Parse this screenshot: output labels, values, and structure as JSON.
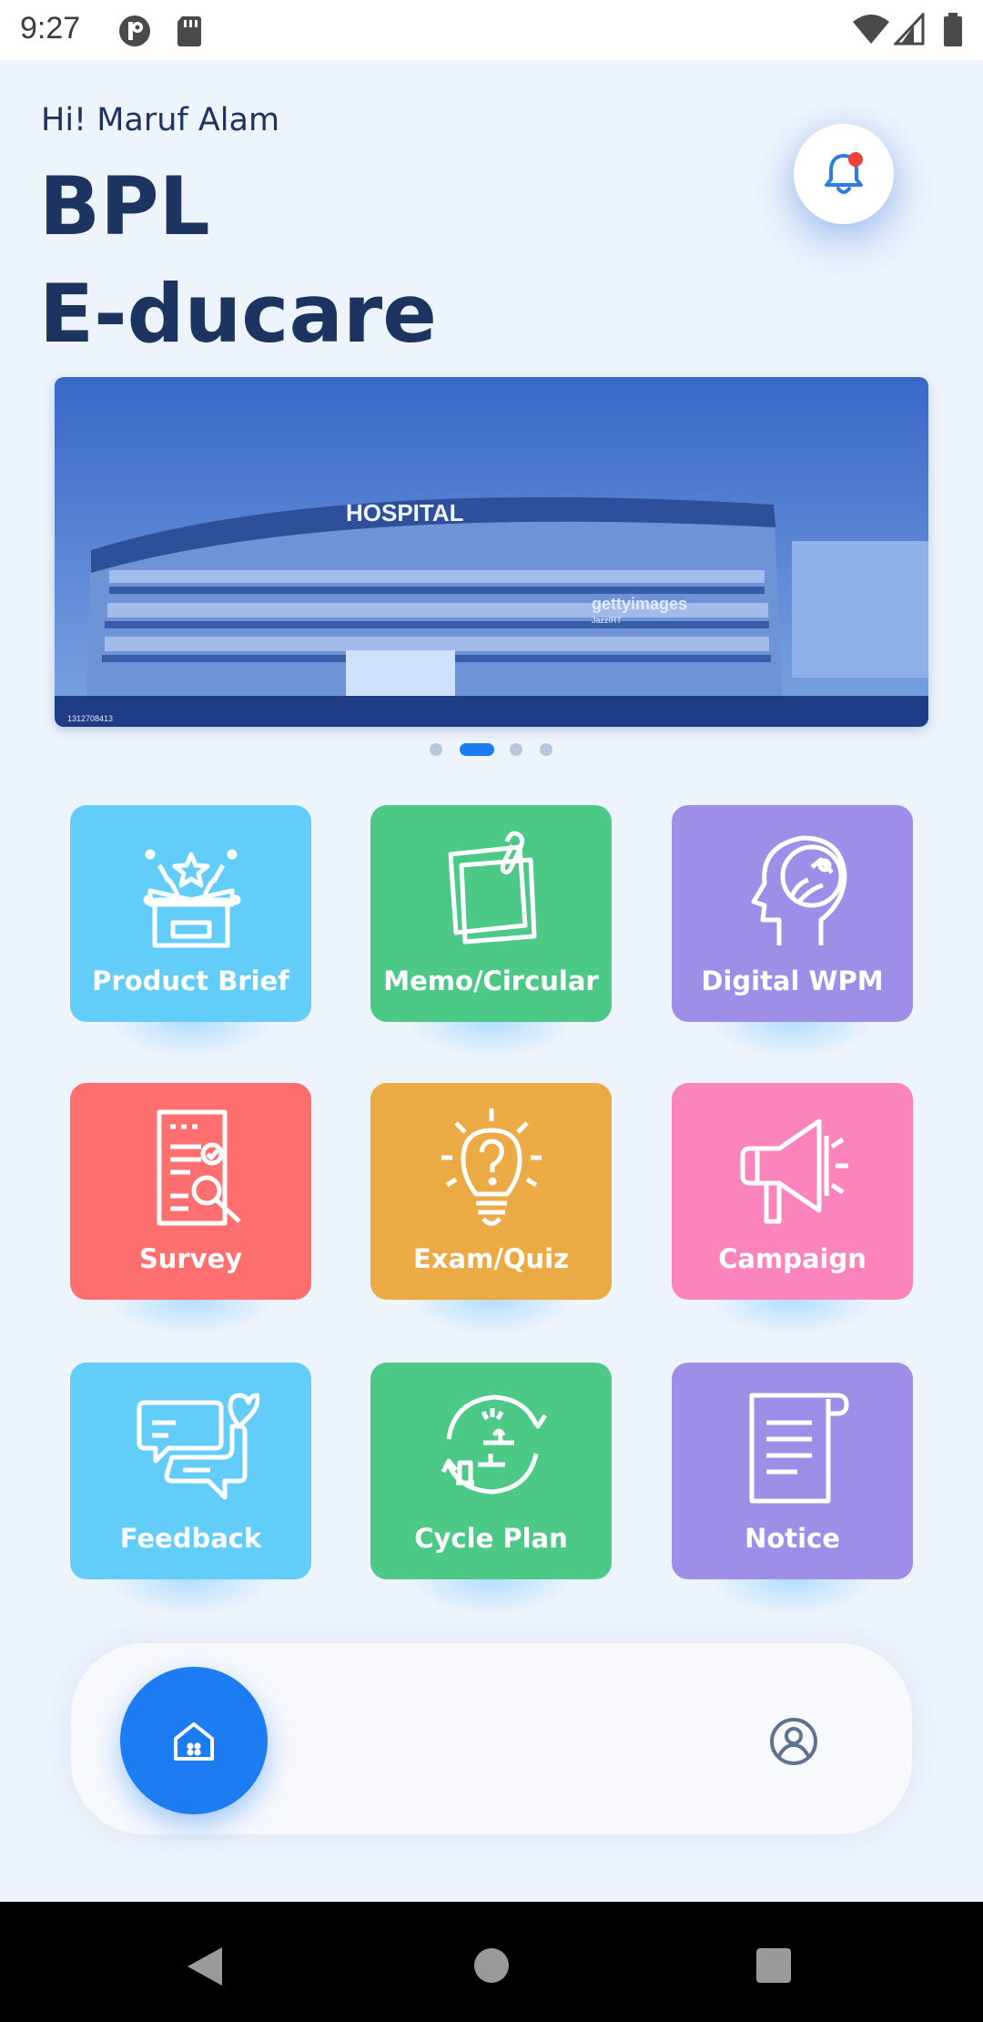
{
  "status_bar": {
    "time": "9:27"
  },
  "header": {
    "greeting": "Hi! Maruf Alam",
    "title_line1": "BPL",
    "title_line2": "E-ducare"
  },
  "banner": {
    "building_sign": "HOSPITAL",
    "watermark": "gettyimages",
    "watermark_credit": "JazzIRT",
    "image_id": "1312708413",
    "slides_total": 4,
    "active_slide": 2
  },
  "tiles": [
    {
      "label": "Product Brief",
      "color": "#63cdfa",
      "icon": "gift-box-icon"
    },
    {
      "label": "Memo/Circular",
      "color": "#4cc986",
      "icon": "memo-paper-icon"
    },
    {
      "label": "Digital WPM",
      "color": "#9f8ee8",
      "icon": "head-image-icon"
    },
    {
      "label": "Survey",
      "color": "#ff6f6f",
      "icon": "survey-document-icon"
    },
    {
      "label": "Exam/Quiz",
      "color": "#ecaa45",
      "icon": "lightbulb-question-icon"
    },
    {
      "label": "Campaign",
      "color": "#fb84bd",
      "icon": "megaphone-icon"
    },
    {
      "label": "Feedback",
      "color": "#63cdfa",
      "icon": "chat-heart-icon"
    },
    {
      "label": "Cycle Plan",
      "color": "#4cc986",
      "icon": "cycle-plan-icon"
    },
    {
      "label": "Notice",
      "color": "#9f8ee8",
      "icon": "notice-scroll-icon"
    }
  ],
  "bottom_nav": {
    "home_icon": "home-icon",
    "profile_icon": "profile-icon"
  },
  "colors": {
    "primary": "#1d7cf2",
    "text": "#1d3461",
    "background": "#eef4fc"
  }
}
